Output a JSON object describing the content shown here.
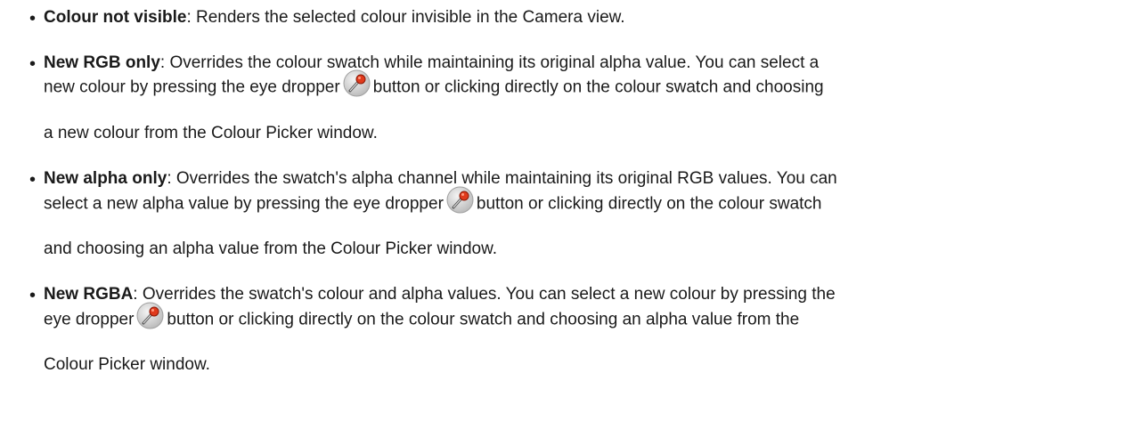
{
  "items": [
    {
      "term": "Colour not visible",
      "lines": [
        ": Renders the selected colour invisible in the Camera view."
      ]
    },
    {
      "term": "New RGB only",
      "line1_before": ": Overrides the colour swatch while maintaining its original alpha value. You can select a",
      "line2_before": "new colour by pressing the eye dropper",
      "line2_after": "button or clicking directly on the colour swatch and choosing",
      "line3": "a new colour from the Colour Picker window."
    },
    {
      "term": "New alpha only",
      "line1_before": ": Overrides the swatch's alpha channel while maintaining its original RGB values. You can",
      "line2_before": "select a new alpha value by pressing the eye dropper",
      "line2_after": "button or clicking directly on the colour swatch",
      "line3": "and choosing an alpha value from the Colour Picker window."
    },
    {
      "term": "New RGBA",
      "line1_before": ": Overrides the swatch's colour and alpha values. You can select a new colour by pressing the",
      "line2_before": "eye dropper",
      "line2_after": "button or clicking directly on the colour swatch and choosing an alpha value from the",
      "line3": "Colour Picker window."
    }
  ],
  "icons": {
    "eye_dropper": "eye-dropper-icon"
  },
  "colors": {
    "text": "#1a1a1a",
    "dropper_tip": "#e03a1c",
    "dropper_bg": "#d9d9d9"
  }
}
